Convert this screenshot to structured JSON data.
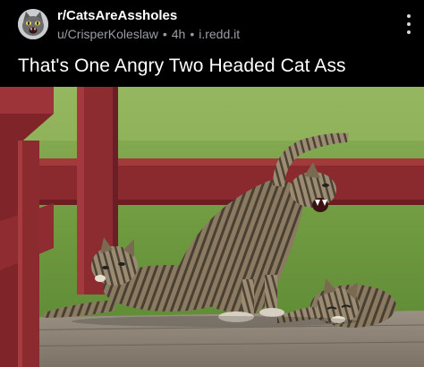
{
  "post": {
    "subreddit": "r/CatsAreAssholes",
    "author": "u/CrisperKoleslaw",
    "age": "4h",
    "separator": "•",
    "domain": "i.redd.it",
    "title": "That's One Angry Two Headed Cat Ass"
  },
  "icons": {
    "subreddit_avatar": "angry-cat-avatar",
    "overflow": "more-vertical-icon"
  },
  "colors": {
    "background": "#000000",
    "meta_text": "#9a9ea3",
    "grass": "#6e9a3f",
    "railing": "#8c2a2f",
    "deck": "#8f8577"
  }
}
